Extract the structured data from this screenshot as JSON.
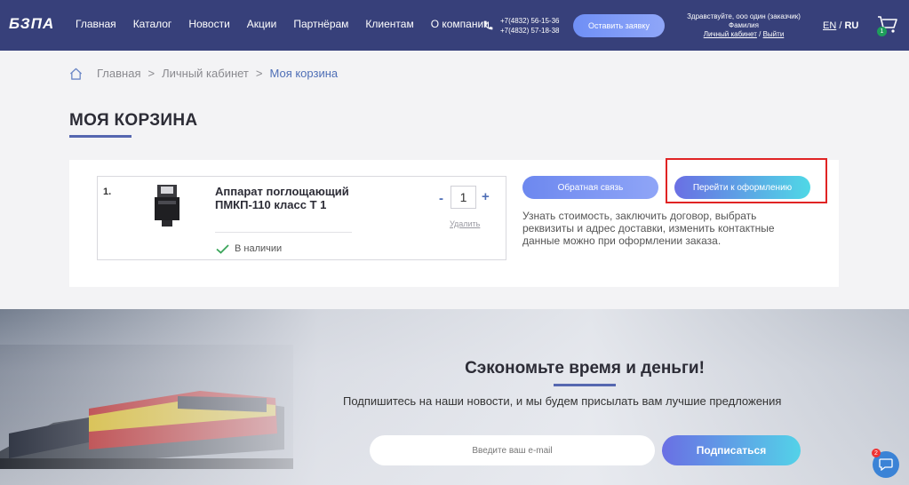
{
  "header": {
    "logo_text": "БЗПА",
    "nav": [
      "Главная",
      "Каталог",
      "Новости",
      "Акции",
      "Партнёрам",
      "Клиентам",
      "О компании"
    ],
    "phones": [
      "+7(4832) 56-15-36",
      "+7(4832) 57-18-38"
    ],
    "order_button": "Оставить заявку",
    "greeting_line1": "Здравствуйте, ооо один (заказчик)",
    "greeting_line2": "Фамилия",
    "account_link": "Личный кабинет",
    "slash": "/",
    "logout_link": "Выйти",
    "lang_en": "EN",
    "lang_sep": "/",
    "lang_ru": "RU",
    "cart_count": "1"
  },
  "breadcrumb": {
    "items": [
      "Главная",
      "Личный кабинет",
      "Моя корзина"
    ],
    "sep": ">"
  },
  "page_title": "МОЯ КОРЗИНА",
  "cart": {
    "item_index": "1.",
    "item_name": "Аппарат поглощающий ПМКП-110 класс Т 1",
    "stock": "В наличии",
    "qty_minus": "-",
    "qty_value": "1",
    "qty_plus": "+",
    "remove": "Удалить",
    "callback_button": "Обратная связь",
    "checkout_button": "Перейти к оформлению",
    "checkout_note": "Узнать стоимость, заключить договор, выбрать реквизиты и адрес доставки, изменить контактные данные можно при оформлении заказа."
  },
  "subscribe": {
    "title": "Сэкономьте время и деньги!",
    "subtitle": "Подпишитесь на наши новости, и мы будем присылать вам лучшие предложения",
    "email_placeholder": "Введите ваш e-mail",
    "button": "Подписаться",
    "chat_badge": "2"
  },
  "colors": {
    "header_bg": "#37407a",
    "accent": "#5567b0",
    "highlight": "#e02424"
  }
}
